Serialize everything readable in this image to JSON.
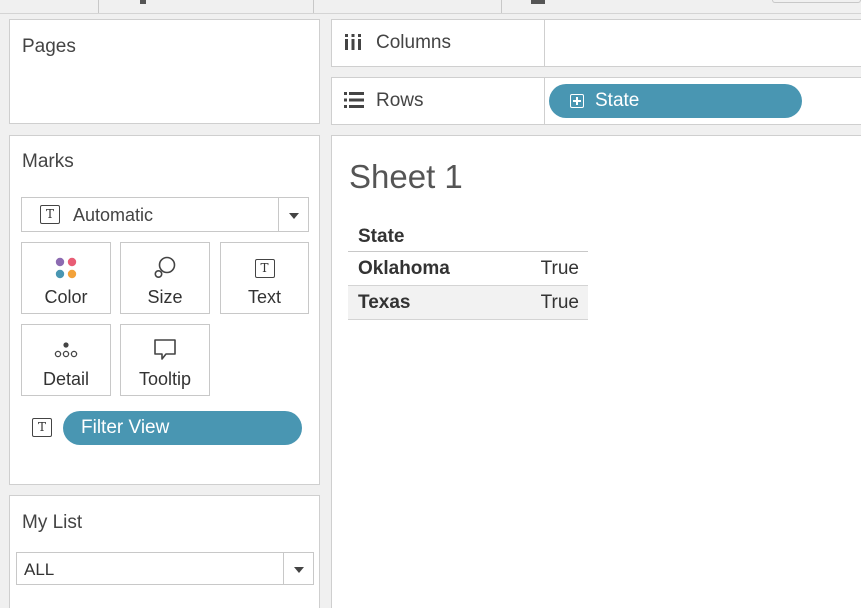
{
  "pages": {
    "title": "Pages"
  },
  "columns_shelf": {
    "label": "Columns",
    "pills": []
  },
  "rows_shelf": {
    "label": "Rows",
    "pills": [
      {
        "label": "State"
      }
    ]
  },
  "marks": {
    "title": "Marks",
    "mark_type": "Automatic",
    "buttons": {
      "color": "Color",
      "size": "Size",
      "text": "Text",
      "detail": "Detail",
      "tooltip": "Tooltip"
    },
    "fields": [
      {
        "label": "Filter View",
        "encoding_icon": "text-icon"
      }
    ],
    "color_dots": [
      "#e85d75",
      "#4996b2",
      "#8c6bb1",
      "#f3a23a"
    ]
  },
  "my_list": {
    "title": "My List",
    "value": "ALL"
  },
  "view": {
    "title": "Sheet 1",
    "table": {
      "header": "State",
      "rows": [
        {
          "state": "Oklahoma",
          "value": "True"
        },
        {
          "state": "Texas",
          "value": "True"
        }
      ]
    }
  },
  "colors": {
    "pill": "#4996b2",
    "panel_border": "#cfcfcf",
    "background": "#f0f0f0"
  }
}
